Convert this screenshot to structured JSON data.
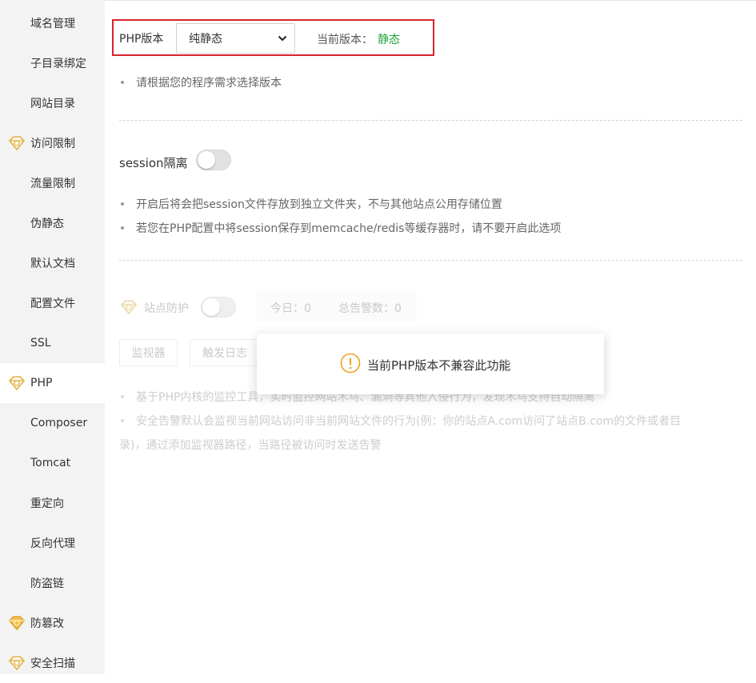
{
  "sidebar": {
    "items": [
      {
        "label": "域名管理",
        "icon": ""
      },
      {
        "label": "子目录绑定",
        "icon": ""
      },
      {
        "label": "网站目录",
        "icon": ""
      },
      {
        "label": "访问限制",
        "icon": "pro-gem-icon"
      },
      {
        "label": "流量限制",
        "icon": ""
      },
      {
        "label": "伪静态",
        "icon": ""
      },
      {
        "label": "默认文档",
        "icon": ""
      },
      {
        "label": "配置文件",
        "icon": ""
      },
      {
        "label": "SSL",
        "icon": ""
      },
      {
        "label": "PHP",
        "icon": "pro-gem-icon",
        "active": true
      },
      {
        "label": "Composer",
        "icon": ""
      },
      {
        "label": "Tomcat",
        "icon": ""
      },
      {
        "label": "重定向",
        "icon": ""
      },
      {
        "label": "反向代理",
        "icon": ""
      },
      {
        "label": "防盗链",
        "icon": ""
      },
      {
        "label": "防篡改",
        "icon": "enterprise-gem-icon"
      },
      {
        "label": "安全扫描",
        "icon": "pro-gem-icon"
      }
    ]
  },
  "php": {
    "label": "PHP版本",
    "select_value": "纯静态",
    "current_label": "当前版本：",
    "current_value": "静态",
    "hint": "请根据您的程序需求选择版本"
  },
  "session": {
    "label": "session隔离",
    "enabled": false,
    "notes": [
      "开启后将会把session文件存放到独立文件夹，不与其他站点公用存储位置",
      "若您在PHP配置中将session保存到memcache/redis等缓存器时，请不要开启此选项"
    ]
  },
  "protection": {
    "label": "站点防护",
    "today": "今日：0",
    "total": "总告警数：0",
    "btn_monitor": "监视器",
    "btn_log": "触发日志",
    "note1": "基于PHP内核的监控工具，实时监控网站木马、漏洞等其他入侵行为，发现木马支持自动隔离",
    "note2_line1": "安全告警默认会监视当前网站访问非当前网站文件的行为(例：你的站点A.com访问了站点B.com的文件或者目",
    "note2_line2": "录)，通过添加监视器路径，当路径被访问时发送告警"
  },
  "toast": {
    "message": "当前PHP版本不兼容此功能",
    "icon": "warning-circle-icon"
  },
  "colors": {
    "accent_green": "#20a53a",
    "highlight_red": "#d9232d",
    "toast_icon": "#f0a020",
    "gem_gold": "#e3b34a"
  }
}
